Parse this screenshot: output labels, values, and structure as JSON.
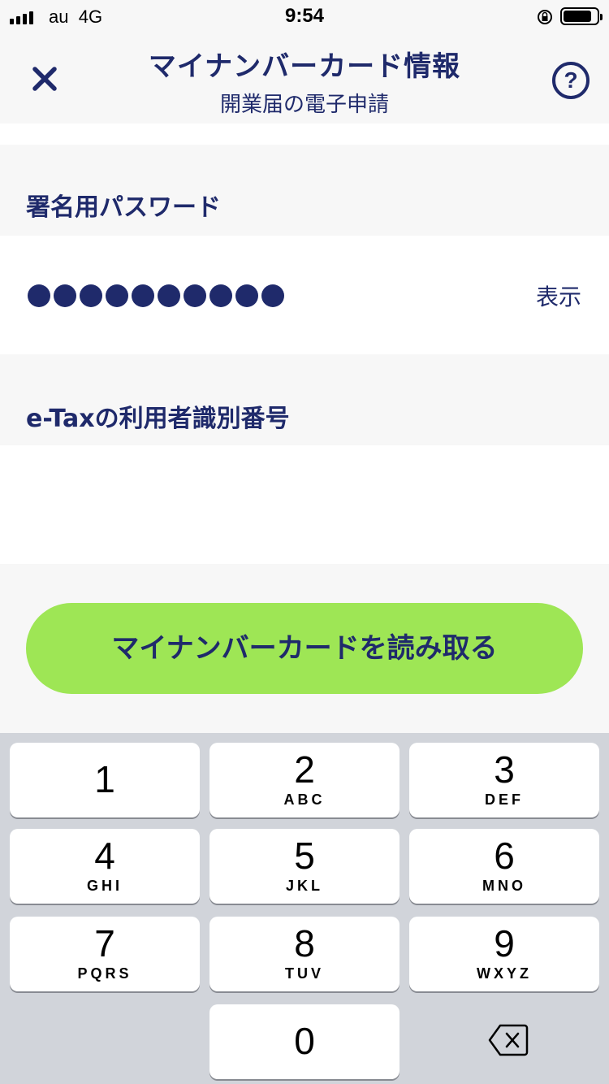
{
  "status_bar": {
    "carrier": "au",
    "network": "4G",
    "time": "9:54"
  },
  "header": {
    "title": "マイナンバーカード情報",
    "subtitle": "開業届の電子申請",
    "help_label": "?"
  },
  "password_section": {
    "label": "署名用パスワード",
    "masked_length": 10,
    "show_label": "表示"
  },
  "etax_section": {
    "label": "e-Taxの利用者識別番号",
    "value": ""
  },
  "read_button": {
    "label": "マイナンバーカードを読み取る"
  },
  "keypad": {
    "keys": [
      {
        "num": "1",
        "letters": ""
      },
      {
        "num": "2",
        "letters": "ABC"
      },
      {
        "num": "3",
        "letters": "DEF"
      },
      {
        "num": "4",
        "letters": "GHI"
      },
      {
        "num": "5",
        "letters": "JKL"
      },
      {
        "num": "6",
        "letters": "MNO"
      },
      {
        "num": "7",
        "letters": "PQRS"
      },
      {
        "num": "8",
        "letters": "TUV"
      },
      {
        "num": "9",
        "letters": "WXYZ"
      },
      {
        "num": "0",
        "letters": ""
      }
    ]
  },
  "colors": {
    "navy": "#1f2a6b",
    "green_button": "#9ee655",
    "keypad_bg": "#d1d4da"
  }
}
